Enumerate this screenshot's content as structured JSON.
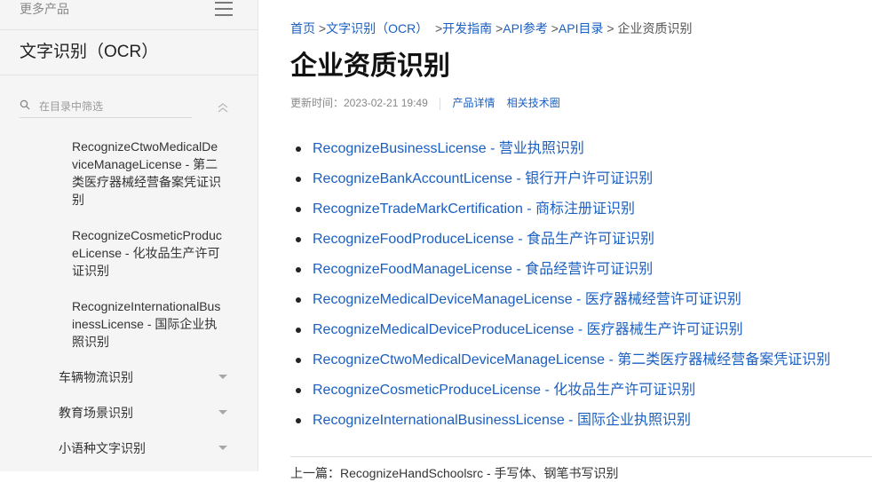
{
  "sidebar": {
    "more_products": "更多产品",
    "title": "文字识别（OCR）",
    "filter_placeholder": "在目录中筛选",
    "tree_items": [
      "RecognizeCtwoMedicalDeviceManageLicense - 第二类医疗器械经营备案凭证识别",
      "RecognizeCosmeticProduceLicense - 化妆品生产许可证识别",
      "RecognizeInternationalBusinessLicense - 国际企业执照识别"
    ],
    "categories": [
      "车辆物流识别",
      "教育场景识别",
      "小语种文字识别"
    ]
  },
  "breadcrumb": {
    "items": [
      "首页",
      "文字识别（OCR）",
      "开发指南",
      "API参考",
      "API目录"
    ],
    "sep": ">",
    "current": "企业资质识别"
  },
  "page": {
    "title": "企业资质识别",
    "updated": "更新时间：2023-02-21 19:49",
    "links": [
      "产品详情",
      "相关技术圈"
    ]
  },
  "api_list": [
    "RecognizeBusinessLicense - 营业执照识别",
    "RecognizeBankAccountLicense - 银行开户许可证识别",
    "RecognizeTradeMarkCertification - 商标注册证识别",
    "RecognizeFoodProduceLicense - 食品生产许可证识别",
    "RecognizeFoodManageLicense - 食品经营许可证识别",
    "RecognizeMedicalDeviceManageLicense - 医疗器械经营许可证识别",
    "RecognizeMedicalDeviceProduceLicense - 医疗器械生产许可证识别",
    "RecognizeCtwoMedicalDeviceManageLicense - 第二类医疗器械经营备案凭证识别",
    "RecognizeCosmeticProduceLicense - 化妆品生产许可证识别",
    "RecognizeInternationalBusinessLicense - 国际企业执照识别"
  ],
  "footer": {
    "prev": "上一篇：RecognizeHandSchoolsrc - 手写体、钢笔书写识别"
  }
}
